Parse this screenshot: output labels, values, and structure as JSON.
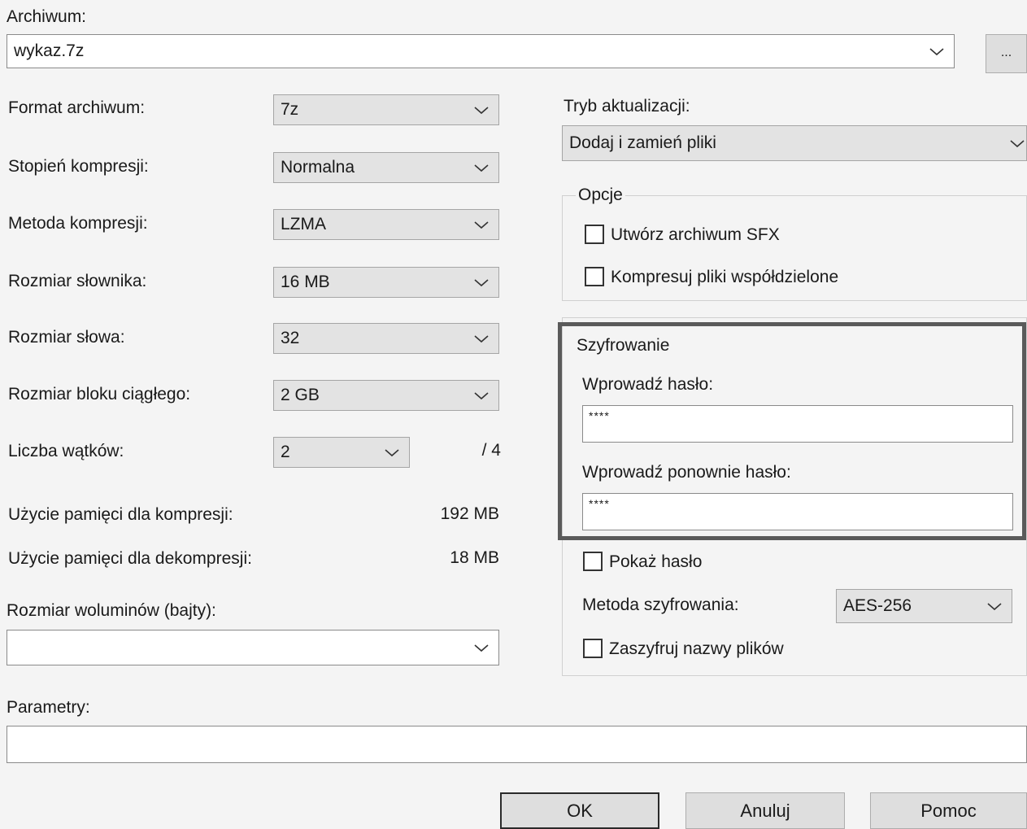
{
  "archive": {
    "label": "Archiwum:",
    "value": "wykaz.7z",
    "browse_label": "..."
  },
  "left": {
    "format": {
      "label": "Format archiwum:",
      "value": "7z"
    },
    "level": {
      "label": "Stopień kompresji:",
      "value": "Normalna"
    },
    "method": {
      "label": "Metoda kompresji:",
      "value": "LZMA"
    },
    "dictionary": {
      "label": "Rozmiar słownika:",
      "value": "16 MB"
    },
    "word": {
      "label": "Rozmiar słowa:",
      "value": "32"
    },
    "solid": {
      "label": "Rozmiar bloku ciągłego:",
      "value": "2 GB"
    },
    "threads": {
      "label": "Liczba wątków:",
      "value": "2",
      "max": "/ 4"
    },
    "mem_compress": {
      "label": "Użycie pamięci dla kompresji:",
      "value": "192 MB"
    },
    "mem_decompress": {
      "label": "Użycie pamięci dla dekompresji:",
      "value": "18 MB"
    },
    "volumes": {
      "label": "Rozmiar woluminów (bajty):",
      "value": ""
    },
    "params": {
      "label": "Parametry:",
      "value": ""
    }
  },
  "right": {
    "update_mode": {
      "label": "Tryb aktualizacji:",
      "value": "Dodaj i zamień pliki"
    },
    "options": {
      "title": "Opcje",
      "sfx": "Utwórz archiwum SFX",
      "shared": "Kompresuj pliki współdzielone"
    },
    "encryption": {
      "title": "Szyfrowanie",
      "password_label": "Wprowadź hasło:",
      "password_value": "****",
      "repeat_label": "Wprowadź ponownie hasło:",
      "repeat_value": "****",
      "show_password": "Pokaż hasło",
      "method_label": "Metoda szyfrowania:",
      "method_value": "AES-256",
      "encrypt_names": "Zaszyfruj nazwy plików"
    }
  },
  "buttons": {
    "ok": "OK",
    "cancel": "Anuluj",
    "help": "Pomoc"
  },
  "colors": {
    "highlight_border": "#5a5a5a",
    "panel_bg": "#f4f4f4",
    "combo_bg": "#e3e3e3"
  }
}
